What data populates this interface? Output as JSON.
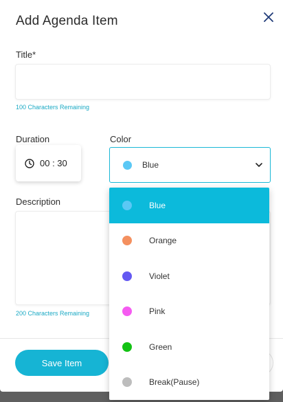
{
  "modal": {
    "title": "Add Agenda Item"
  },
  "form": {
    "title_label": "Title*",
    "title_value": "",
    "title_hint": "100 Characters Remaining",
    "duration_label": "Duration",
    "duration_value": "00 : 30",
    "color_label": "Color",
    "color_selected": "Blue",
    "description_label": "Description",
    "description_hint": "200 Characters Remaining"
  },
  "footer": {
    "save_label": "Save Item"
  },
  "color_options": [
    {
      "label": "Blue",
      "color": "#5bc8f5",
      "selected": true
    },
    {
      "label": "Orange",
      "color": "#f4905f",
      "selected": false
    },
    {
      "label": "Violet",
      "color": "#6459f2",
      "selected": false
    },
    {
      "label": "Pink",
      "color": "#f55bf1",
      "selected": false
    },
    {
      "label": "Green",
      "color": "#13c214",
      "selected": false
    },
    {
      "label": "Break(Pause)",
      "color": "#bdbdbd",
      "selected": false
    }
  ],
  "colors": {
    "accent": "#16b4d4",
    "selected_dot": "#5bc8f5"
  }
}
